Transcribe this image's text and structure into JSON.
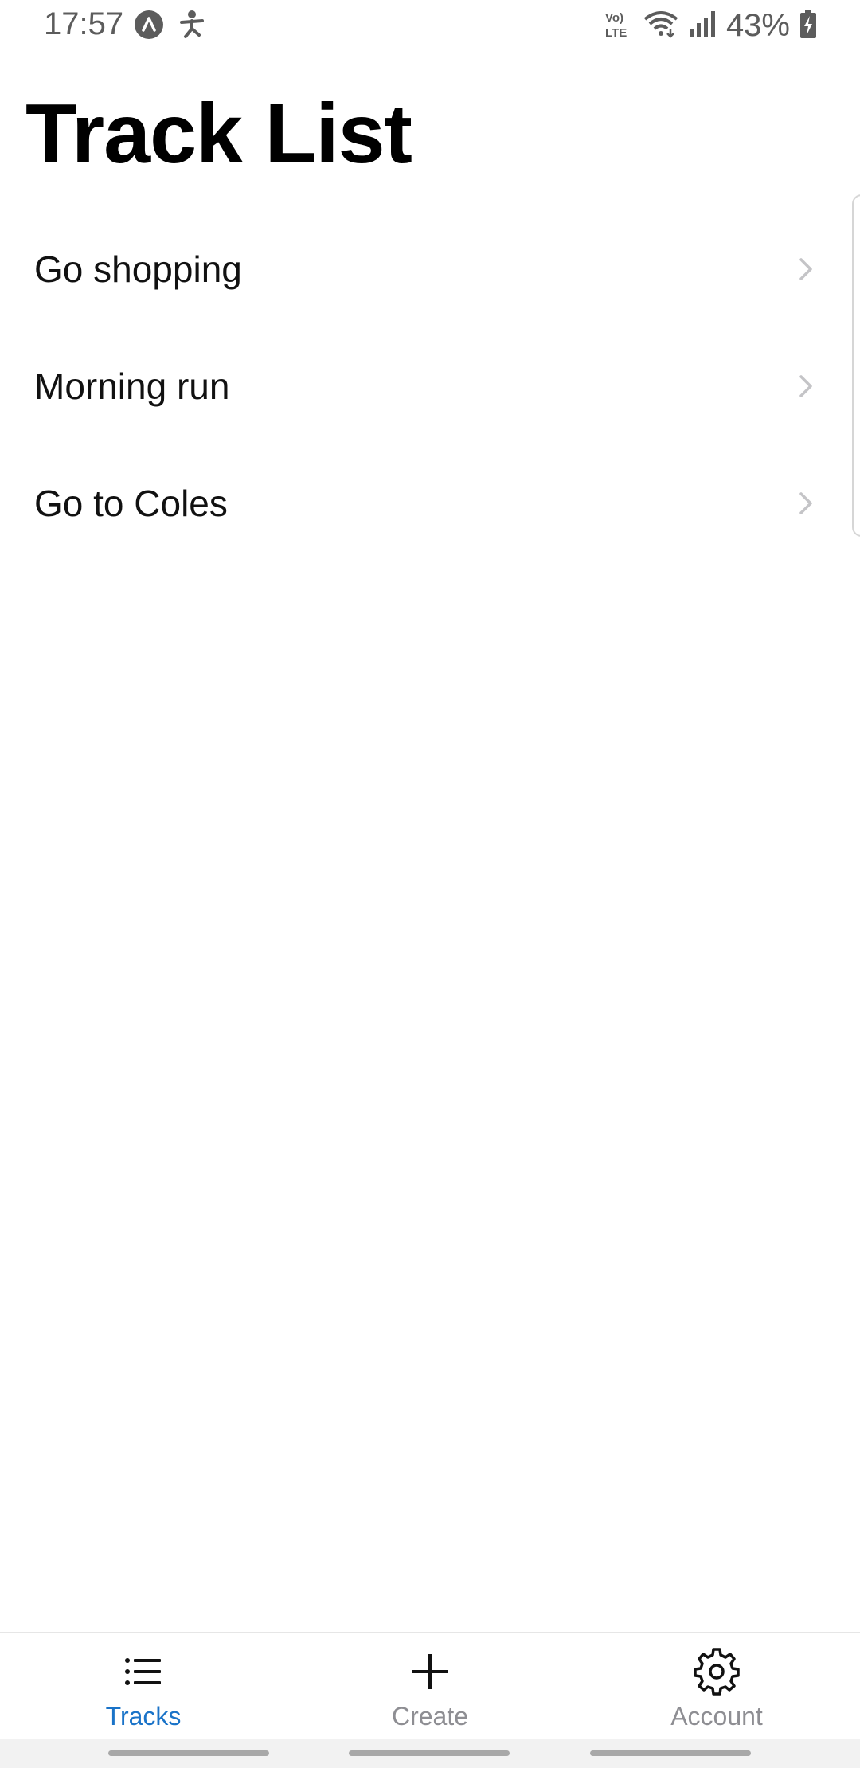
{
  "status_bar": {
    "time": "17:57",
    "battery": "43%",
    "network_label": "Vo) LTE",
    "left_icons": [
      "app-notification-icon",
      "accessibility-icon"
    ],
    "right_icons": [
      "volte-icon",
      "wifi-icon",
      "signal-icon",
      "battery-charging-icon"
    ]
  },
  "page": {
    "title": "Track List"
  },
  "tracks": [
    {
      "label": "Go shopping"
    },
    {
      "label": "Morning run"
    },
    {
      "label": "Go to Coles"
    }
  ],
  "tab_bar": {
    "tabs": [
      {
        "label": "Tracks",
        "icon": "list-icon",
        "active": true
      },
      {
        "label": "Create",
        "icon": "plus-icon",
        "active": false
      },
      {
        "label": "Account",
        "icon": "gear-icon",
        "active": false
      }
    ],
    "active_color": "#1a73c8",
    "inactive_color": "#8e8e93"
  }
}
